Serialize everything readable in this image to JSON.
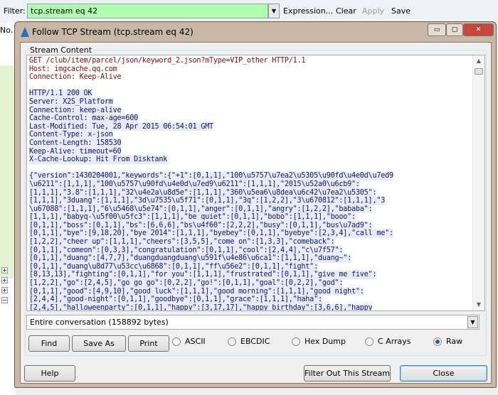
{
  "filter_bar": {
    "label": "Filter:",
    "value": "tcp.stream eq 42",
    "expression": "Expression...",
    "clear": "Clear",
    "apply": "Apply",
    "save": "Save"
  },
  "background": {
    "column_no": "No."
  },
  "dialog": {
    "title": "Follow TCP Stream (tcp.stream eq 42)",
    "group_label": "Stream Content",
    "request_lines": [
      "GET /club/item/parcel/json/keyword_2.json?mType=VIP_other HTTP/1.1",
      "Host: imgcache.qq.com",
      "Connection: Keep-Alive"
    ],
    "response_lines": [
      "HTTP/1.1 200 OK",
      "Server: X2S_Platform",
      "Connection: keep-alive",
      "Cache-Control: max-age=600",
      "Last-Modified: Tue, 28 Apr 2015 06:54:01 GMT",
      "Content-Type: x-json",
      "Content-Length: 158530",
      "Keep-Alive: timeout=60",
      "X-Cache-Lookup: Hit From Disktank"
    ],
    "body_lines": [
      "{\"version\":1430204001,\"keywords\":{\"+1\":[0,1,1],\"100\\u5757\\u7ea2\\u5305\\u90fd\\u4e0d\\u7ed9",
      "\\u6211\":[1,1,1],\"100\\u5757\\u90fd\\u4e0d\\u7ed9\\u6211\":[1,1,1],\"2015\\u52a0\\u6cb9\":",
      "[1,1,1],\"3.8\":[1,1,1],\"32\\u4e2a\\u8d5e\":[1,1,1],\"360\\u5ea6\\u8dea\\u6c42\\u7ea2\\u5305\":",
      "[1,1,1],\"3duang\":[1,1,1],\"3d\\u7535\\u5f71\":[0,1,1],\"3q\":[1,2,2],\"3\\u670812\":[1,1,1],\"3",
      "\\u67088\":[1,1,1],\"6\\u5468\\u5e74\":[0,1,1],\"anger\":[0,1,1],\"angry\":[1,2,2],\"bababa\":",
      "[1,1,1],\"babyq-\\u5f00\\u5fc3\":[1,1,1],\"be quiet\":[0,1,1],\"bobo\":[1,1,1],\"booo\":",
      "[0,1,1],\"boss\":[0,1,1],\"bs\":[6,6,6],\"bs\\u4f60\":[2,2,2],\"busy\":[0,1,1],\"bus\\u7ad9\":",
      "[0,1,1],\"bye\":[9,18,20],\"bye 2014\":[1,1,1],\"byebey\":[0,1,1],\"byebye\":[2,3,4],\"call me\":",
      "[1,2,2],\"cheer up\":[1,1,1],\"cheers\":[3,5,5],\"come on\":[1,3,3],\"comeback\":",
      "[0,1,1],\"comeon\":[0,3,3],\"congratulation\":[0,1,1],\"cool\":[2,4,4],\"c\\u7f57\":",
      "[0,1,1],\"duang\":[4,7,7],\"duangduangduang\\u591f\\u4e86\\u6ca1\":[1,1,1],\"duang~\":",
      "[0,1,1],\"duang\\u8d77\\u53cc\\u6868\":[0,1,1],\"ff\\u56e2\":[0,1,1],\"fight\":",
      "[8,13,13],\"fighting\":[0,1,1],\"for you\":[1,1,1],\"frustrated\":[0,1,1],\"give me five\":",
      "[1,2,2],\"go\":[2,4,5],\"go go go\":[0,2,2],\"go!\":[0,1,1],\"goal\":[0,2,2],\"god\":",
      "[0,1,1],\"good\":[4,9,10],\"good luck\":[1,1,1],\"good morning\":[1,1,1],\"good night\":",
      "[2,4,4],\"good-night\":[0,1,1],\"goodbye\":[0,1,1],\"grace\":[1,1,1],\"haha\":",
      "[2,4,5],\"halloweenparty\":[0,1,1],\"happy\":[3,17,17],\"happy birthday\":[3,6,6],\"happy"
    ],
    "conversation_select": "Entire conversation (158892 bytes)",
    "buttons": {
      "find": "Find",
      "save_as": "Save As",
      "print": "Print",
      "help": "Help",
      "filter_out": "Filter Out This Stream",
      "close": "Close"
    },
    "formats": [
      {
        "label": "ASCII",
        "selected": false
      },
      {
        "label": "EBCDIC",
        "selected": false
      },
      {
        "label": "Hex Dump",
        "selected": false
      },
      {
        "label": "C Arrays",
        "selected": false
      },
      {
        "label": "Raw",
        "selected": true
      }
    ]
  },
  "colors": {
    "filter_valid": "#afffaf",
    "client_text": "#8b0a0a",
    "server_text": "#0a1a70"
  }
}
